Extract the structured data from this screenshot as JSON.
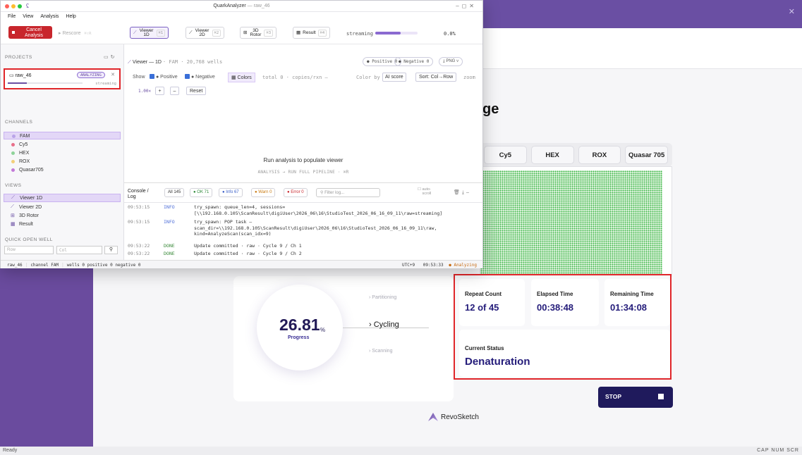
{
  "background_app": {
    "heading_fragment": "ge",
    "dye_tabs": [
      "Cy5",
      "HEX",
      "ROX",
      "Quasar 705"
    ],
    "progress": {
      "value": "26.81",
      "unit": "%",
      "label": "Progress"
    },
    "steps": [
      "Partitioning",
      "Cycling",
      "Scanning"
    ],
    "stats": {
      "repeat_label": "Repeat Count",
      "repeat_value": "12 of 45",
      "elapsed_label": "Elapsed Time",
      "elapsed_value": "00:38:48",
      "remaining_label": "Remaining Time",
      "remaining_value": "01:34:08",
      "status_label": "Current Status",
      "status_value": "Denaturation"
    },
    "stop_label": "STOP",
    "logo_text": "RevoSketch",
    "statusbar": {
      "left": "Ready",
      "right": "CAP  NUM  SCR"
    }
  },
  "window": {
    "title": "QuarkAnalyzer",
    "title_sub": "— raw_46",
    "menu": [
      "File",
      "View",
      "Analysis",
      "Help"
    ],
    "toolbar": {
      "cancel_label": "Cancel Analysis",
      "rescore_label": "▸ Rescore",
      "rescore_kbd": "⌘⇧R",
      "views": [
        {
          "label": "Viewer 1D",
          "kbd": "⌘1"
        },
        {
          "label": "Viewer 2D",
          "kbd": "⌘2"
        },
        {
          "label": "3D Rotor",
          "kbd": "⌘3"
        },
        {
          "label": "Result",
          "kbd": "⌘4"
        }
      ],
      "stream_label": "streaming",
      "stream_fraction": 0.6,
      "stream_pct": "0.0%"
    },
    "left_panel": {
      "projects_header": "PROJECTS",
      "project": {
        "name": "raw_46",
        "badge": "ANALYZING",
        "stream": "streaming",
        "progress_fraction": 0.25
      },
      "channels_header": "CHANNELS",
      "channels": [
        {
          "name": "FAM",
          "color": "#b9a3e8"
        },
        {
          "name": "Cy5",
          "color": "#e8708a"
        },
        {
          "name": "HEX",
          "color": "#8fd39a"
        },
        {
          "name": "ROX",
          "color": "#f2cf7a"
        },
        {
          "name": "Quasar705",
          "color": "#c27ad8"
        }
      ],
      "views_header": "VIEWS",
      "views": [
        {
          "icon": "line-chart-icon",
          "label": "Viewer 1D"
        },
        {
          "icon": "line-chart-icon",
          "label": "Viewer 2D"
        },
        {
          "icon": "rotor-icon",
          "label": "3D Rotor"
        },
        {
          "icon": "grid-icon",
          "label": "Result"
        }
      ],
      "quick_open_header": "QUICK OPEN WELL",
      "row_placeholder": "Row",
      "col_placeholder": "Col"
    },
    "viewer": {
      "title": "Viewer — 1D",
      "subtitle": "· FAM · 20,768 wells",
      "positive_chip": "● Positive 0",
      "negative_chip": "● Negative 0",
      "png_chip": "⤓ PNG ∨",
      "show_label": "Show",
      "positive_label": "● Positive",
      "negative_label": "● Negative",
      "colors_label": "▦ Colors",
      "total_label": "total 0 · copies/rxn —",
      "color_by_label": "Color by",
      "ai_label": "AI score",
      "sort_label": "Sort: Col→Row",
      "zoom_label": "zoom",
      "zoom_value": "1.00×",
      "reset_label": "Reset",
      "empty_title": "Run analysis to populate viewer",
      "empty_sub": "ANALYSIS → RUN FULL PIPELINE · ⌘R"
    },
    "console": {
      "title": "Console / Log",
      "filters": {
        "all": "All 145",
        "ok": "● OK 71",
        "info": "● Info 67",
        "warn": "● Warn 0",
        "error": "● Error 0"
      },
      "filter_placeholder": "Filter log...",
      "auto_scroll": "auto-scroll",
      "logs": [
        {
          "time": "09:53:15",
          "level": "INFO",
          "msg": "try_spawn: queue_len=4, sessions=[\\\\192.168.0.105\\ScanResult\\digiUser\\2026_06\\16\\StudioTest_2026_06_16_09_11\\raw=streaming]"
        },
        {
          "time": "09:53:15",
          "level": "INFO",
          "msg": "try_spawn: POP task — scan_dir=\\\\192.168.0.105\\ScanResult\\digiUser\\2026_06\\16\\StudioTest_2026_06_16_09_11\\raw, kind=AnalyzeScan(scan_idx=9)"
        },
        {
          "time": "09:53:22",
          "level": "DONE",
          "msg": "Update committed · raw · Cycle 9 / Ch 1"
        },
        {
          "time": "09:53:22",
          "level": "DONE",
          "msg": "Update committed · raw · Cycle 9 / Ch 2"
        }
      ]
    },
    "statusbar": {
      "project": "raw_46",
      "channel": "channel FAM",
      "wells": "wells 0  positive 0  negative 0",
      "tz": "UTC+9",
      "time": "09:53:33",
      "state": "● Analyzing"
    }
  }
}
